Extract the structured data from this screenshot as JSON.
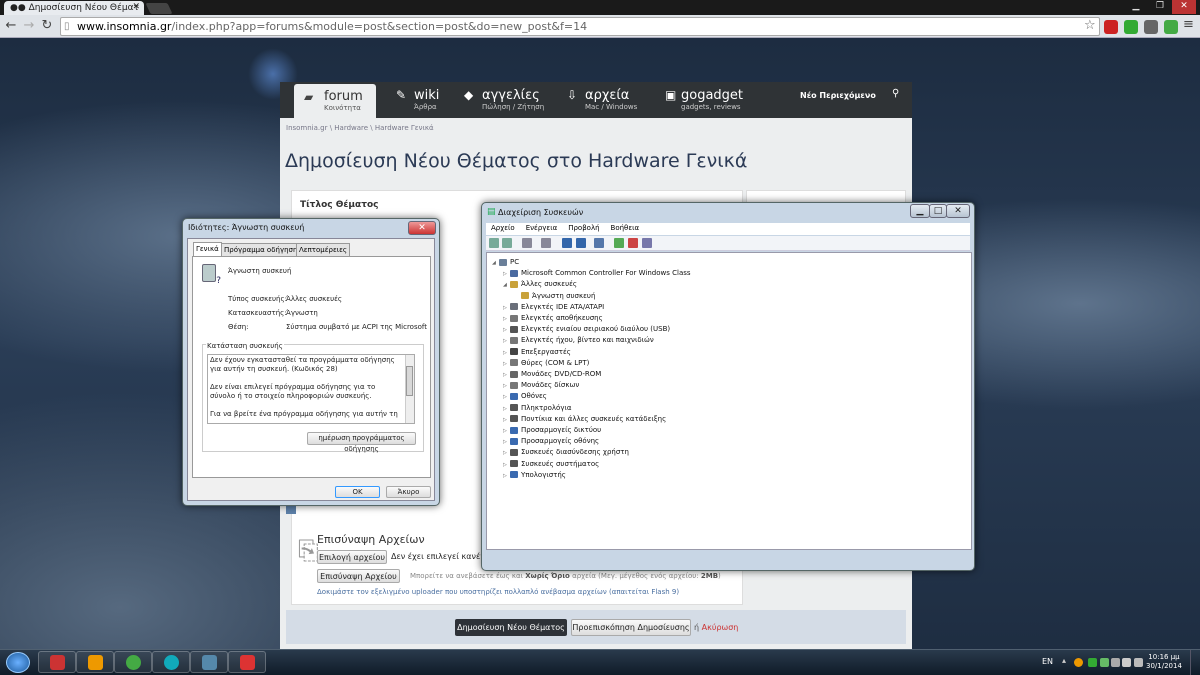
{
  "browser": {
    "tab_title": "Δημοσίευση Νέου Θέματ",
    "url_host": "www.insomnia.gr",
    "url_path": "/index.php?app=forums&module=post&section=post&do=new_post&f=14"
  },
  "site": {
    "nav": [
      {
        "label": "forum",
        "sub": "Κοινότητα"
      },
      {
        "label": "wiki",
        "sub": "Άρθρα"
      },
      {
        "label": "αγγελίες",
        "sub": "Πώληση / Ζήτηση"
      },
      {
        "label": "αρχεία",
        "sub": "Mac / Windows"
      },
      {
        "label": "gogadget",
        "sub": "gadgets, reviews"
      }
    ],
    "nav_right": "Νέο Περιεχόμενο",
    "breadcrumb": "Insomnia.gr  \\  Hardware  \\  Hardware Γενικά",
    "page_title": "Δημοσίευση Νέου Θέματος στο Hardware Γενικά",
    "topic_title_label": "Τίτλος Θέματος",
    "attachments": {
      "heading": "Επισύναψη Αρχείων",
      "choose_button": "Επιλογή αρχείου",
      "no_file": "Δεν έχει επιλεγεί κανένα",
      "upload_button": "Επισύναψη Αρχείου",
      "hint_pre": "Μπορείτε να ανεβάσετε έως και ",
      "hint_bold": "Χωρίς Όριο",
      "hint_post": " αρχεία (Μεγ. μέγεθος ενός αρχείου: ",
      "hint_size": "2MB",
      "hint_end": ")",
      "flash_link": "Δοκιμάστε τον εξελιγμένο uploader που υποστηρίζει πολλαπλό ανέβασμα αρχείων (απαιτείται Flash 9)"
    },
    "submit_label": "Δημοσίευση Νέου Θέματος",
    "preview_label": "Προεπισκόπηση Δημοσίευσης",
    "or_text": "ή",
    "cancel_link": "Ακύρωση"
  },
  "properties_dialog": {
    "title": "Ιδιότητες: Άγνωστη συσκευή",
    "tabs": [
      "Γενικά",
      "Πρόγραμμα οδήγησης",
      "Λεπτομέρειες"
    ],
    "device_name": "Άγνωστη συσκευή",
    "props": [
      {
        "label": "Τύπος συσκευής:",
        "value": "Άλλες συσκευές"
      },
      {
        "label": "Κατασκευαστής:",
        "value": "Άγνωστη"
      },
      {
        "label": "Θέση:",
        "value": "Σύστημα συμβατό με ACPI της Microsoft"
      }
    ],
    "status_group": "Κατάσταση συσκευής",
    "status_lines": [
      "Δεν έχουν εγκατασταθεί τα προγράμματα οδήγησης για αυτήν τη συσκευή. (Κωδικός 28)",
      "",
      "Δεν είναι επιλεγεί πρόγραμμα οδήγησης για το σύνολο ή το στοιχείο πληροφοριών συσκευής.",
      "",
      "Για να βρείτε ένα πρόγραμμα οδήγησης για αυτήν τη"
    ],
    "update_button": "ημέρωση προγράμματος οδήγησης",
    "ok": "OK",
    "cancel": "Άκυρο"
  },
  "device_manager": {
    "title": "Διαχείριση Συσκευών",
    "menu": [
      "Αρχείο",
      "Ενέργεια",
      "Προβολή",
      "Βοήθεια"
    ],
    "tree": [
      {
        "label": "PC",
        "level": 0,
        "arrow": "◢"
      },
      {
        "label": "Microsoft Common Controller For Windows Class",
        "level": 1,
        "arrow": "▷"
      },
      {
        "label": "Άλλες συσκευές",
        "level": 1,
        "arrow": "◢"
      },
      {
        "label": "Άγνωστη συσκευή",
        "level": 2,
        "arrow": ""
      },
      {
        "label": "Ελεγκτές IDE ATA/ATAPI",
        "level": 1,
        "arrow": "▷"
      },
      {
        "label": "Ελεγκτές αποθήκευσης",
        "level": 1,
        "arrow": "▷"
      },
      {
        "label": "Ελεγκτές ενιαίου σειριακού διαύλου (USB)",
        "level": 1,
        "arrow": "▷"
      },
      {
        "label": "Ελεγκτές ήχου, βίντεο και παιχνιδιών",
        "level": 1,
        "arrow": "▷"
      },
      {
        "label": "Επεξεργαστές",
        "level": 1,
        "arrow": "▷"
      },
      {
        "label": "Θύρες (COM & LPT)",
        "level": 1,
        "arrow": "▷"
      },
      {
        "label": "Μονάδες DVD/CD-ROM",
        "level": 1,
        "arrow": "▷"
      },
      {
        "label": "Μονάδες δίσκων",
        "level": 1,
        "arrow": "▷"
      },
      {
        "label": "Οθόνες",
        "level": 1,
        "arrow": "▷"
      },
      {
        "label": "Πληκτρολόγια",
        "level": 1,
        "arrow": "▷"
      },
      {
        "label": "Ποντίκια και άλλες συσκευές κατάδειξης",
        "level": 1,
        "arrow": "▷"
      },
      {
        "label": "Προσαρμογείς δικτύου",
        "level": 1,
        "arrow": "▷"
      },
      {
        "label": "Προσαρμογείς οθόνης",
        "level": 1,
        "arrow": "▷"
      },
      {
        "label": "Συσκευές διασύνδεσης χρήστη",
        "level": 1,
        "arrow": "▷"
      },
      {
        "label": "Συσκευές συστήματος",
        "level": 1,
        "arrow": "▷"
      },
      {
        "label": "Υπολογιστής",
        "level": 1,
        "arrow": "▷"
      }
    ]
  },
  "taskbar": {
    "lang": "EN",
    "time": "10:16 μμ",
    "date": "30/1/2014"
  }
}
